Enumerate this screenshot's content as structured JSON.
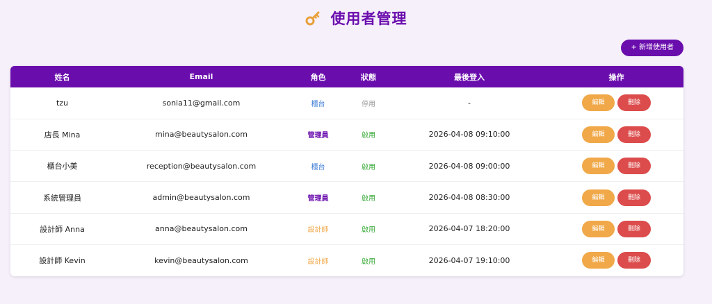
{
  "header": {
    "icon": "key-icon",
    "title": "使用者管理"
  },
  "toolbar": {
    "add_label": "+ 新增使用者"
  },
  "colors": {
    "primary": "#6a0dad",
    "edit": "#f0a848",
    "delete": "#dc4c4c",
    "role_counter": "#3a7bd5",
    "role_designer": "#f0a848",
    "status_on": "#3aaa3a",
    "status_off": "#9a9a9a"
  },
  "table": {
    "headers": {
      "name": "姓名",
      "email": "Email",
      "role": "角色",
      "status": "狀態",
      "last_login": "最後登入",
      "actions": "操作"
    },
    "rows": [
      {
        "name": "tzu",
        "email": "sonia11@gmail.com",
        "role": "櫃台",
        "status": "停用",
        "last_login": "-",
        "edit": "編輯",
        "delete": "刪除"
      },
      {
        "name": "店長 Mina",
        "email": "mina@beautysalon.com",
        "role": "管理員",
        "status": "啟用",
        "last_login": "2026-04-08 09:10:00",
        "edit": "編輯",
        "delete": "刪除"
      },
      {
        "name": "櫃台小美",
        "email": "reception@beautysalon.com",
        "role": "櫃台",
        "status": "啟用",
        "last_login": "2026-04-08 09:00:00",
        "edit": "編輯",
        "delete": "刪除"
      },
      {
        "name": "系統管理員",
        "email": "admin@beautysalon.com",
        "role": "管理員",
        "status": "啟用",
        "last_login": "2026-04-08 08:30:00",
        "edit": "編輯",
        "delete": "刪除"
      },
      {
        "name": "設計師 Anna",
        "email": "anna@beautysalon.com",
        "role": "設計師",
        "status": "啟用",
        "last_login": "2026-04-07 18:20:00",
        "edit": "編輯",
        "delete": "刪除"
      },
      {
        "name": "設計師 Kevin",
        "email": "kevin@beautysalon.com",
        "role": "設計師",
        "status": "啟用",
        "last_login": "2026-04-07 19:10:00",
        "edit": "編輯",
        "delete": "刪除"
      }
    ]
  }
}
